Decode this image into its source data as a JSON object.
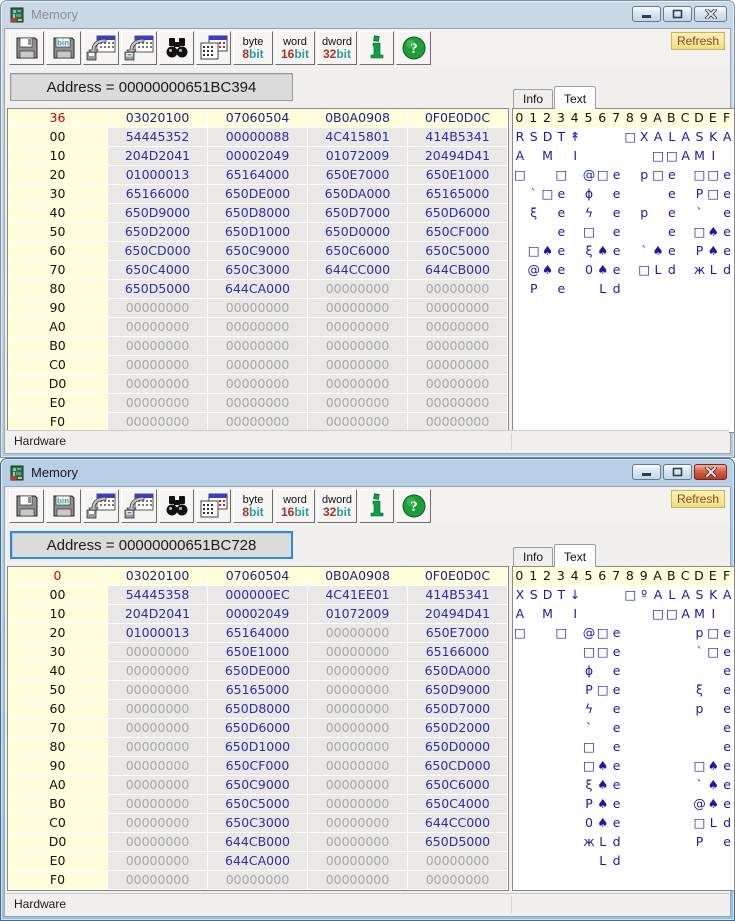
{
  "zero_value": "00000000",
  "toolbar": {
    "bin_label": "bin",
    "refresh_label": "Refresh",
    "size_buttons": [
      {
        "line1": "byte",
        "num": "8",
        "unit": "bit"
      },
      {
        "line1": "word",
        "num": "16",
        "unit": "bit"
      },
      {
        "line1": "dword",
        "num": "32",
        "unit": "bit"
      }
    ]
  },
  "windows": [
    {
      "title": "Memory",
      "focused": false,
      "address_label": "Address = 00000000651BC394",
      "status": "Hardware",
      "tabs": {
        "info": "Info",
        "text": "Text"
      },
      "hex": {
        "corner": "36",
        "col_headers": [
          "03020100",
          "07060504",
          "0B0A0908",
          "0F0E0D0C"
        ],
        "row_labels": [
          "00",
          "10",
          "20",
          "30",
          "40",
          "50",
          "60",
          "70",
          "80",
          "90",
          "A0",
          "B0",
          "C0",
          "D0",
          "E0",
          "F0"
        ],
        "rows": [
          [
            "54445352",
            "00000088",
            "4C415801",
            "414B5341"
          ],
          [
            "204D2041",
            "00002049",
            "01072009",
            "20494D41"
          ],
          [
            "01000013",
            "65164000",
            "650E7000",
            "650E1000"
          ],
          [
            "65166000",
            "650DE000",
            "650DA000",
            "65165000"
          ],
          [
            "650D9000",
            "650D8000",
            "650D7000",
            "650D6000"
          ],
          [
            "650D2000",
            "650D1000",
            "650D0000",
            "650CF000"
          ],
          [
            "650CD000",
            "650C9000",
            "650C6000",
            "650C5000"
          ],
          [
            "650C4000",
            "650C3000",
            "644CC000",
            "644CB000"
          ],
          [
            "650D5000",
            "644CA000",
            "00000000",
            "00000000"
          ],
          [
            "00000000",
            "00000000",
            "00000000",
            "00000000"
          ],
          [
            "00000000",
            "00000000",
            "00000000",
            "00000000"
          ],
          [
            "00000000",
            "00000000",
            "00000000",
            "00000000"
          ],
          [
            "00000000",
            "00000000",
            "00000000",
            "00000000"
          ],
          [
            "00000000",
            "00000000",
            "00000000",
            "00000000"
          ],
          [
            "00000000",
            "00000000",
            "00000000",
            "00000000"
          ],
          [
            "00000000",
            "00000000",
            "00000000",
            "00000000"
          ]
        ]
      },
      "text_grid": {
        "header": [
          "0",
          "1",
          "2",
          "3",
          "4",
          "5",
          "6",
          "7",
          "8",
          "9",
          "A",
          "B",
          "C",
          "D",
          "E",
          "F"
        ],
        "rows": [
          [
            "R",
            "S",
            "D",
            "T",
            "↟",
            "",
            "",
            "",
            "□",
            "X",
            "A",
            "L",
            "A",
            "S",
            "K",
            "A"
          ],
          [
            "A",
            "",
            "M",
            "",
            "I",
            "",
            "",
            "",
            "",
            "",
            "□",
            "□",
            "A",
            "M",
            "I",
            ""
          ],
          [
            "□",
            "",
            "",
            "□",
            "",
            "@",
            "□",
            "e",
            "",
            "p",
            "□",
            "e",
            "",
            "□",
            "□",
            "e"
          ],
          [
            "",
            "`",
            "□",
            "e",
            "",
            "ɸ",
            "",
            "e",
            "",
            "",
            "",
            "e",
            "",
            "P",
            "□",
            "e"
          ],
          [
            "",
            "ξ",
            "",
            "e",
            "",
            "ϟ",
            "",
            "e",
            "",
            "p",
            "",
            "e",
            "",
            "`",
            "",
            "e"
          ],
          [
            "",
            "",
            "",
            "e",
            "",
            "□",
            "",
            "e",
            "",
            "",
            "",
            "e",
            "",
            "□",
            "♠",
            "e"
          ],
          [
            "",
            "□",
            "♠",
            "e",
            "",
            "ξ",
            "♠",
            "e",
            "",
            "`",
            "♠",
            "e",
            "",
            "P",
            "♠",
            "e"
          ],
          [
            "",
            "@",
            "♠",
            "e",
            "",
            "0",
            "♠",
            "e",
            "",
            "□",
            "L",
            "d",
            "",
            "ж",
            "L",
            "d"
          ],
          [
            "",
            "P",
            "",
            "e",
            "",
            "",
            "L",
            "d",
            "",
            "",
            "",
            "",
            "",
            "",
            "",
            ""
          ],
          [
            "",
            "",
            "",
            "",
            "",
            "",
            "",
            "",
            "",
            "",
            "",
            "",
            "",
            "",
            "",
            ""
          ],
          [
            "",
            "",
            "",
            "",
            "",
            "",
            "",
            "",
            "",
            "",
            "",
            "",
            "",
            "",
            "",
            ""
          ],
          [
            "",
            "",
            "",
            "",
            "",
            "",
            "",
            "",
            "",
            "",
            "",
            "",
            "",
            "",
            "",
            ""
          ],
          [
            "",
            "",
            "",
            "",
            "",
            "",
            "",
            "",
            "",
            "",
            "",
            "",
            "",
            "",
            "",
            ""
          ],
          [
            "",
            "",
            "",
            "",
            "",
            "",
            "",
            "",
            "",
            "",
            "",
            "",
            "",
            "",
            "",
            ""
          ],
          [
            "",
            "",
            "",
            "",
            "",
            "",
            "",
            "",
            "",
            "",
            "",
            "",
            "",
            "",
            "",
            ""
          ],
          [
            "",
            "",
            "",
            "",
            "",
            "",
            "",
            "",
            "",
            "",
            "",
            "",
            "",
            "",
            "",
            ""
          ]
        ]
      }
    },
    {
      "title": "Memory",
      "focused": true,
      "address_label": "Address = 00000000651BC728",
      "status": "Hardware",
      "tabs": {
        "info": "Info",
        "text": "Text"
      },
      "hex": {
        "corner": "0",
        "col_headers": [
          "03020100",
          "07060504",
          "0B0A0908",
          "0F0E0D0C"
        ],
        "row_labels": [
          "00",
          "10",
          "20",
          "30",
          "40",
          "50",
          "60",
          "70",
          "80",
          "90",
          "A0",
          "B0",
          "C0",
          "D0",
          "E0",
          "F0"
        ],
        "rows": [
          [
            "54445358",
            "000000EC",
            "4C41EE01",
            "414B5341"
          ],
          [
            "204D2041",
            "00002049",
            "01072009",
            "20494D41"
          ],
          [
            "01000013",
            "65164000",
            "00000000",
            "650E7000"
          ],
          [
            "00000000",
            "650E1000",
            "00000000",
            "65166000"
          ],
          [
            "00000000",
            "650DE000",
            "00000000",
            "650DA000"
          ],
          [
            "00000000",
            "65165000",
            "00000000",
            "650D9000"
          ],
          [
            "00000000",
            "650D8000",
            "00000000",
            "650D7000"
          ],
          [
            "00000000",
            "650D6000",
            "00000000",
            "650D2000"
          ],
          [
            "00000000",
            "650D1000",
            "00000000",
            "650D0000"
          ],
          [
            "00000000",
            "650CF000",
            "00000000",
            "650CD000"
          ],
          [
            "00000000",
            "650C9000",
            "00000000",
            "650C6000"
          ],
          [
            "00000000",
            "650C5000",
            "00000000",
            "650C4000"
          ],
          [
            "00000000",
            "650C3000",
            "00000000",
            "644CC000"
          ],
          [
            "00000000",
            "644CB000",
            "00000000",
            "650D5000"
          ],
          [
            "00000000",
            "644CA000",
            "00000000",
            "00000000"
          ],
          [
            "00000000",
            "00000000",
            "00000000",
            "00000000"
          ]
        ]
      },
      "text_grid": {
        "header": [
          "0",
          "1",
          "2",
          "3",
          "4",
          "5",
          "6",
          "7",
          "8",
          "9",
          "A",
          "B",
          "C",
          "D",
          "E",
          "F"
        ],
        "rows": [
          [
            "X",
            "S",
            "D",
            "T",
            "↓",
            "",
            "",
            "",
            "□",
            "º",
            "A",
            "L",
            "A",
            "S",
            "K",
            "A"
          ],
          [
            "A",
            "",
            "M",
            "",
            "I",
            "",
            "",
            "",
            "",
            "",
            "□",
            "□",
            "A",
            "M",
            "I",
            ""
          ],
          [
            "□",
            "",
            "",
            "□",
            "",
            "@",
            "□",
            "e",
            "",
            "",
            "",
            "",
            "",
            "p",
            "□",
            "e"
          ],
          [
            "",
            "",
            "",
            "",
            "",
            "□",
            "□",
            "e",
            "",
            "",
            "",
            "",
            "",
            "`",
            "□",
            "e"
          ],
          [
            "",
            "",
            "",
            "",
            "",
            "ɸ",
            "",
            "e",
            "",
            "",
            "",
            "",
            "",
            "",
            "",
            "e"
          ],
          [
            "",
            "",
            "",
            "",
            "",
            "P",
            "□",
            "e",
            "",
            "",
            "",
            "",
            "",
            "ξ",
            "",
            "e"
          ],
          [
            "",
            "",
            "",
            "",
            "",
            "ϟ",
            "",
            "e",
            "",
            "",
            "",
            "",
            "",
            "p",
            "",
            "e"
          ],
          [
            "",
            "",
            "",
            "",
            "",
            "`",
            "",
            "e",
            "",
            "",
            "",
            "",
            "",
            "",
            "",
            "e"
          ],
          [
            "",
            "",
            "",
            "",
            "",
            "□",
            "",
            "e",
            "",
            "",
            "",
            "",
            "",
            "",
            "",
            "e"
          ],
          [
            "",
            "",
            "",
            "",
            "",
            "□",
            "♠",
            "e",
            "",
            "",
            "",
            "",
            "",
            "□",
            "♠",
            "e"
          ],
          [
            "",
            "",
            "",
            "",
            "",
            "ξ",
            "♠",
            "e",
            "",
            "",
            "",
            "",
            "",
            "`",
            "♠",
            "e"
          ],
          [
            "",
            "",
            "",
            "",
            "",
            "P",
            "♠",
            "e",
            "",
            "",
            "",
            "",
            "",
            "@",
            "♠",
            "e"
          ],
          [
            "",
            "",
            "",
            "",
            "",
            "0",
            "♠",
            "e",
            "",
            "",
            "",
            "",
            "",
            "□",
            "L",
            "d"
          ],
          [
            "",
            "",
            "",
            "",
            "",
            "ж",
            "L",
            "d",
            "",
            "",
            "",
            "",
            "",
            "P",
            "",
            "e"
          ],
          [
            "",
            "",
            "",
            "",
            "",
            "",
            "L",
            "d",
            "",
            "",
            "",
            "",
            "",
            "",
            "",
            ""
          ],
          [
            "",
            "",
            "",
            "",
            "",
            "",
            "",
            "",
            "",
            "",
            "",
            "",
            "",
            "",
            "",
            ""
          ]
        ]
      }
    }
  ]
}
